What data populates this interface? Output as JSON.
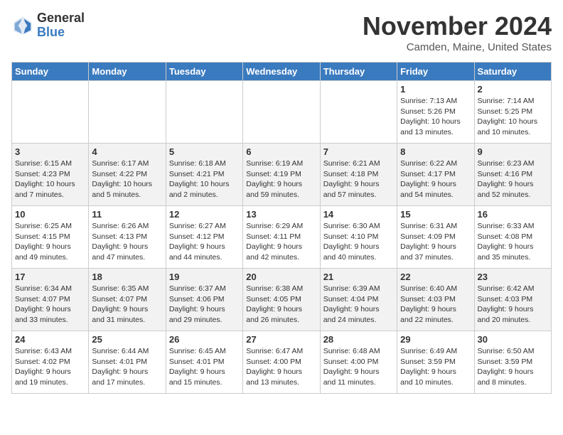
{
  "logo": {
    "general": "General",
    "blue": "Blue"
  },
  "title": "November 2024",
  "location": "Camden, Maine, United States",
  "weekdays": [
    "Sunday",
    "Monday",
    "Tuesday",
    "Wednesday",
    "Thursday",
    "Friday",
    "Saturday"
  ],
  "weeks": [
    [
      {
        "day": "",
        "info": ""
      },
      {
        "day": "",
        "info": ""
      },
      {
        "day": "",
        "info": ""
      },
      {
        "day": "",
        "info": ""
      },
      {
        "day": "",
        "info": ""
      },
      {
        "day": "1",
        "info": "Sunrise: 7:13 AM\nSunset: 5:26 PM\nDaylight: 10 hours\nand 13 minutes."
      },
      {
        "day": "2",
        "info": "Sunrise: 7:14 AM\nSunset: 5:25 PM\nDaylight: 10 hours\nand 10 minutes."
      }
    ],
    [
      {
        "day": "3",
        "info": "Sunrise: 6:15 AM\nSunset: 4:23 PM\nDaylight: 10 hours\nand 7 minutes."
      },
      {
        "day": "4",
        "info": "Sunrise: 6:17 AM\nSunset: 4:22 PM\nDaylight: 10 hours\nand 5 minutes."
      },
      {
        "day": "5",
        "info": "Sunrise: 6:18 AM\nSunset: 4:21 PM\nDaylight: 10 hours\nand 2 minutes."
      },
      {
        "day": "6",
        "info": "Sunrise: 6:19 AM\nSunset: 4:19 PM\nDaylight: 9 hours\nand 59 minutes."
      },
      {
        "day": "7",
        "info": "Sunrise: 6:21 AM\nSunset: 4:18 PM\nDaylight: 9 hours\nand 57 minutes."
      },
      {
        "day": "8",
        "info": "Sunrise: 6:22 AM\nSunset: 4:17 PM\nDaylight: 9 hours\nand 54 minutes."
      },
      {
        "day": "9",
        "info": "Sunrise: 6:23 AM\nSunset: 4:16 PM\nDaylight: 9 hours\nand 52 minutes."
      }
    ],
    [
      {
        "day": "10",
        "info": "Sunrise: 6:25 AM\nSunset: 4:15 PM\nDaylight: 9 hours\nand 49 minutes."
      },
      {
        "day": "11",
        "info": "Sunrise: 6:26 AM\nSunset: 4:13 PM\nDaylight: 9 hours\nand 47 minutes."
      },
      {
        "day": "12",
        "info": "Sunrise: 6:27 AM\nSunset: 4:12 PM\nDaylight: 9 hours\nand 44 minutes."
      },
      {
        "day": "13",
        "info": "Sunrise: 6:29 AM\nSunset: 4:11 PM\nDaylight: 9 hours\nand 42 minutes."
      },
      {
        "day": "14",
        "info": "Sunrise: 6:30 AM\nSunset: 4:10 PM\nDaylight: 9 hours\nand 40 minutes."
      },
      {
        "day": "15",
        "info": "Sunrise: 6:31 AM\nSunset: 4:09 PM\nDaylight: 9 hours\nand 37 minutes."
      },
      {
        "day": "16",
        "info": "Sunrise: 6:33 AM\nSunset: 4:08 PM\nDaylight: 9 hours\nand 35 minutes."
      }
    ],
    [
      {
        "day": "17",
        "info": "Sunrise: 6:34 AM\nSunset: 4:07 PM\nDaylight: 9 hours\nand 33 minutes."
      },
      {
        "day": "18",
        "info": "Sunrise: 6:35 AM\nSunset: 4:07 PM\nDaylight: 9 hours\nand 31 minutes."
      },
      {
        "day": "19",
        "info": "Sunrise: 6:37 AM\nSunset: 4:06 PM\nDaylight: 9 hours\nand 29 minutes."
      },
      {
        "day": "20",
        "info": "Sunrise: 6:38 AM\nSunset: 4:05 PM\nDaylight: 9 hours\nand 26 minutes."
      },
      {
        "day": "21",
        "info": "Sunrise: 6:39 AM\nSunset: 4:04 PM\nDaylight: 9 hours\nand 24 minutes."
      },
      {
        "day": "22",
        "info": "Sunrise: 6:40 AM\nSunset: 4:03 PM\nDaylight: 9 hours\nand 22 minutes."
      },
      {
        "day": "23",
        "info": "Sunrise: 6:42 AM\nSunset: 4:03 PM\nDaylight: 9 hours\nand 20 minutes."
      }
    ],
    [
      {
        "day": "24",
        "info": "Sunrise: 6:43 AM\nSunset: 4:02 PM\nDaylight: 9 hours\nand 19 minutes."
      },
      {
        "day": "25",
        "info": "Sunrise: 6:44 AM\nSunset: 4:01 PM\nDaylight: 9 hours\nand 17 minutes."
      },
      {
        "day": "26",
        "info": "Sunrise: 6:45 AM\nSunset: 4:01 PM\nDaylight: 9 hours\nand 15 minutes."
      },
      {
        "day": "27",
        "info": "Sunrise: 6:47 AM\nSunset: 4:00 PM\nDaylight: 9 hours\nand 13 minutes."
      },
      {
        "day": "28",
        "info": "Sunrise: 6:48 AM\nSunset: 4:00 PM\nDaylight: 9 hours\nand 11 minutes."
      },
      {
        "day": "29",
        "info": "Sunrise: 6:49 AM\nSunset: 3:59 PM\nDaylight: 9 hours\nand 10 minutes."
      },
      {
        "day": "30",
        "info": "Sunrise: 6:50 AM\nSunset: 3:59 PM\nDaylight: 9 hours\nand 8 minutes."
      }
    ]
  ]
}
